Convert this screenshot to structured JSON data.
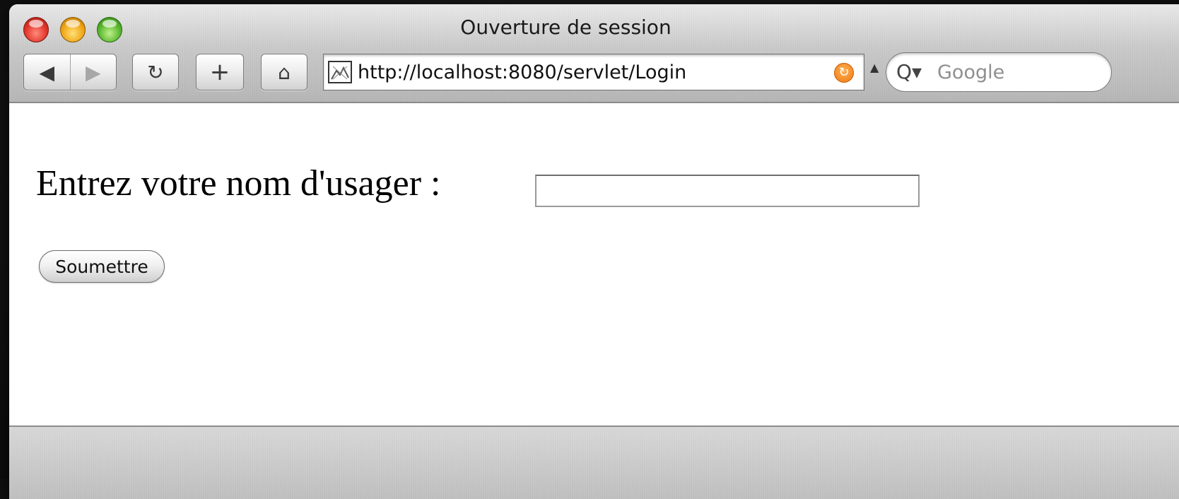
{
  "window": {
    "title": "Ouverture de session"
  },
  "toolbar": {
    "back_icon": "◀",
    "forward_icon": "▶",
    "reload_icon": "↻",
    "add_icon": "+",
    "home_icon": "⌂"
  },
  "address_bar": {
    "url": "http://localhost:8080/servlet/Login",
    "rss_icon": "rss-icon"
  },
  "search": {
    "icon": "Q▾",
    "placeholder": "Google"
  },
  "page": {
    "prompt": "Entrez votre nom d'usager :",
    "username_value": "",
    "submit_label": "Soumettre"
  },
  "colors": {
    "rss_accent": "#f07a10"
  }
}
